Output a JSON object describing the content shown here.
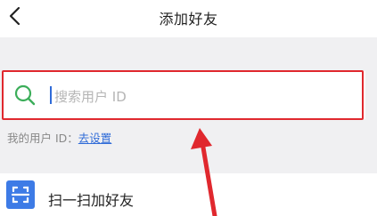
{
  "header": {
    "title": "添加好友",
    "back_icon": "chevron-left-icon"
  },
  "search": {
    "placeholder": "搜索用户 ID",
    "icon": "search-icon"
  },
  "my_id": {
    "label": "我的用户 ID：",
    "link": "去设置"
  },
  "scan": {
    "label": "扫一扫加好友",
    "icon": "scan-icon",
    "icon_color": "#3d7be6"
  },
  "annotation": {
    "color": "#e0282e"
  }
}
